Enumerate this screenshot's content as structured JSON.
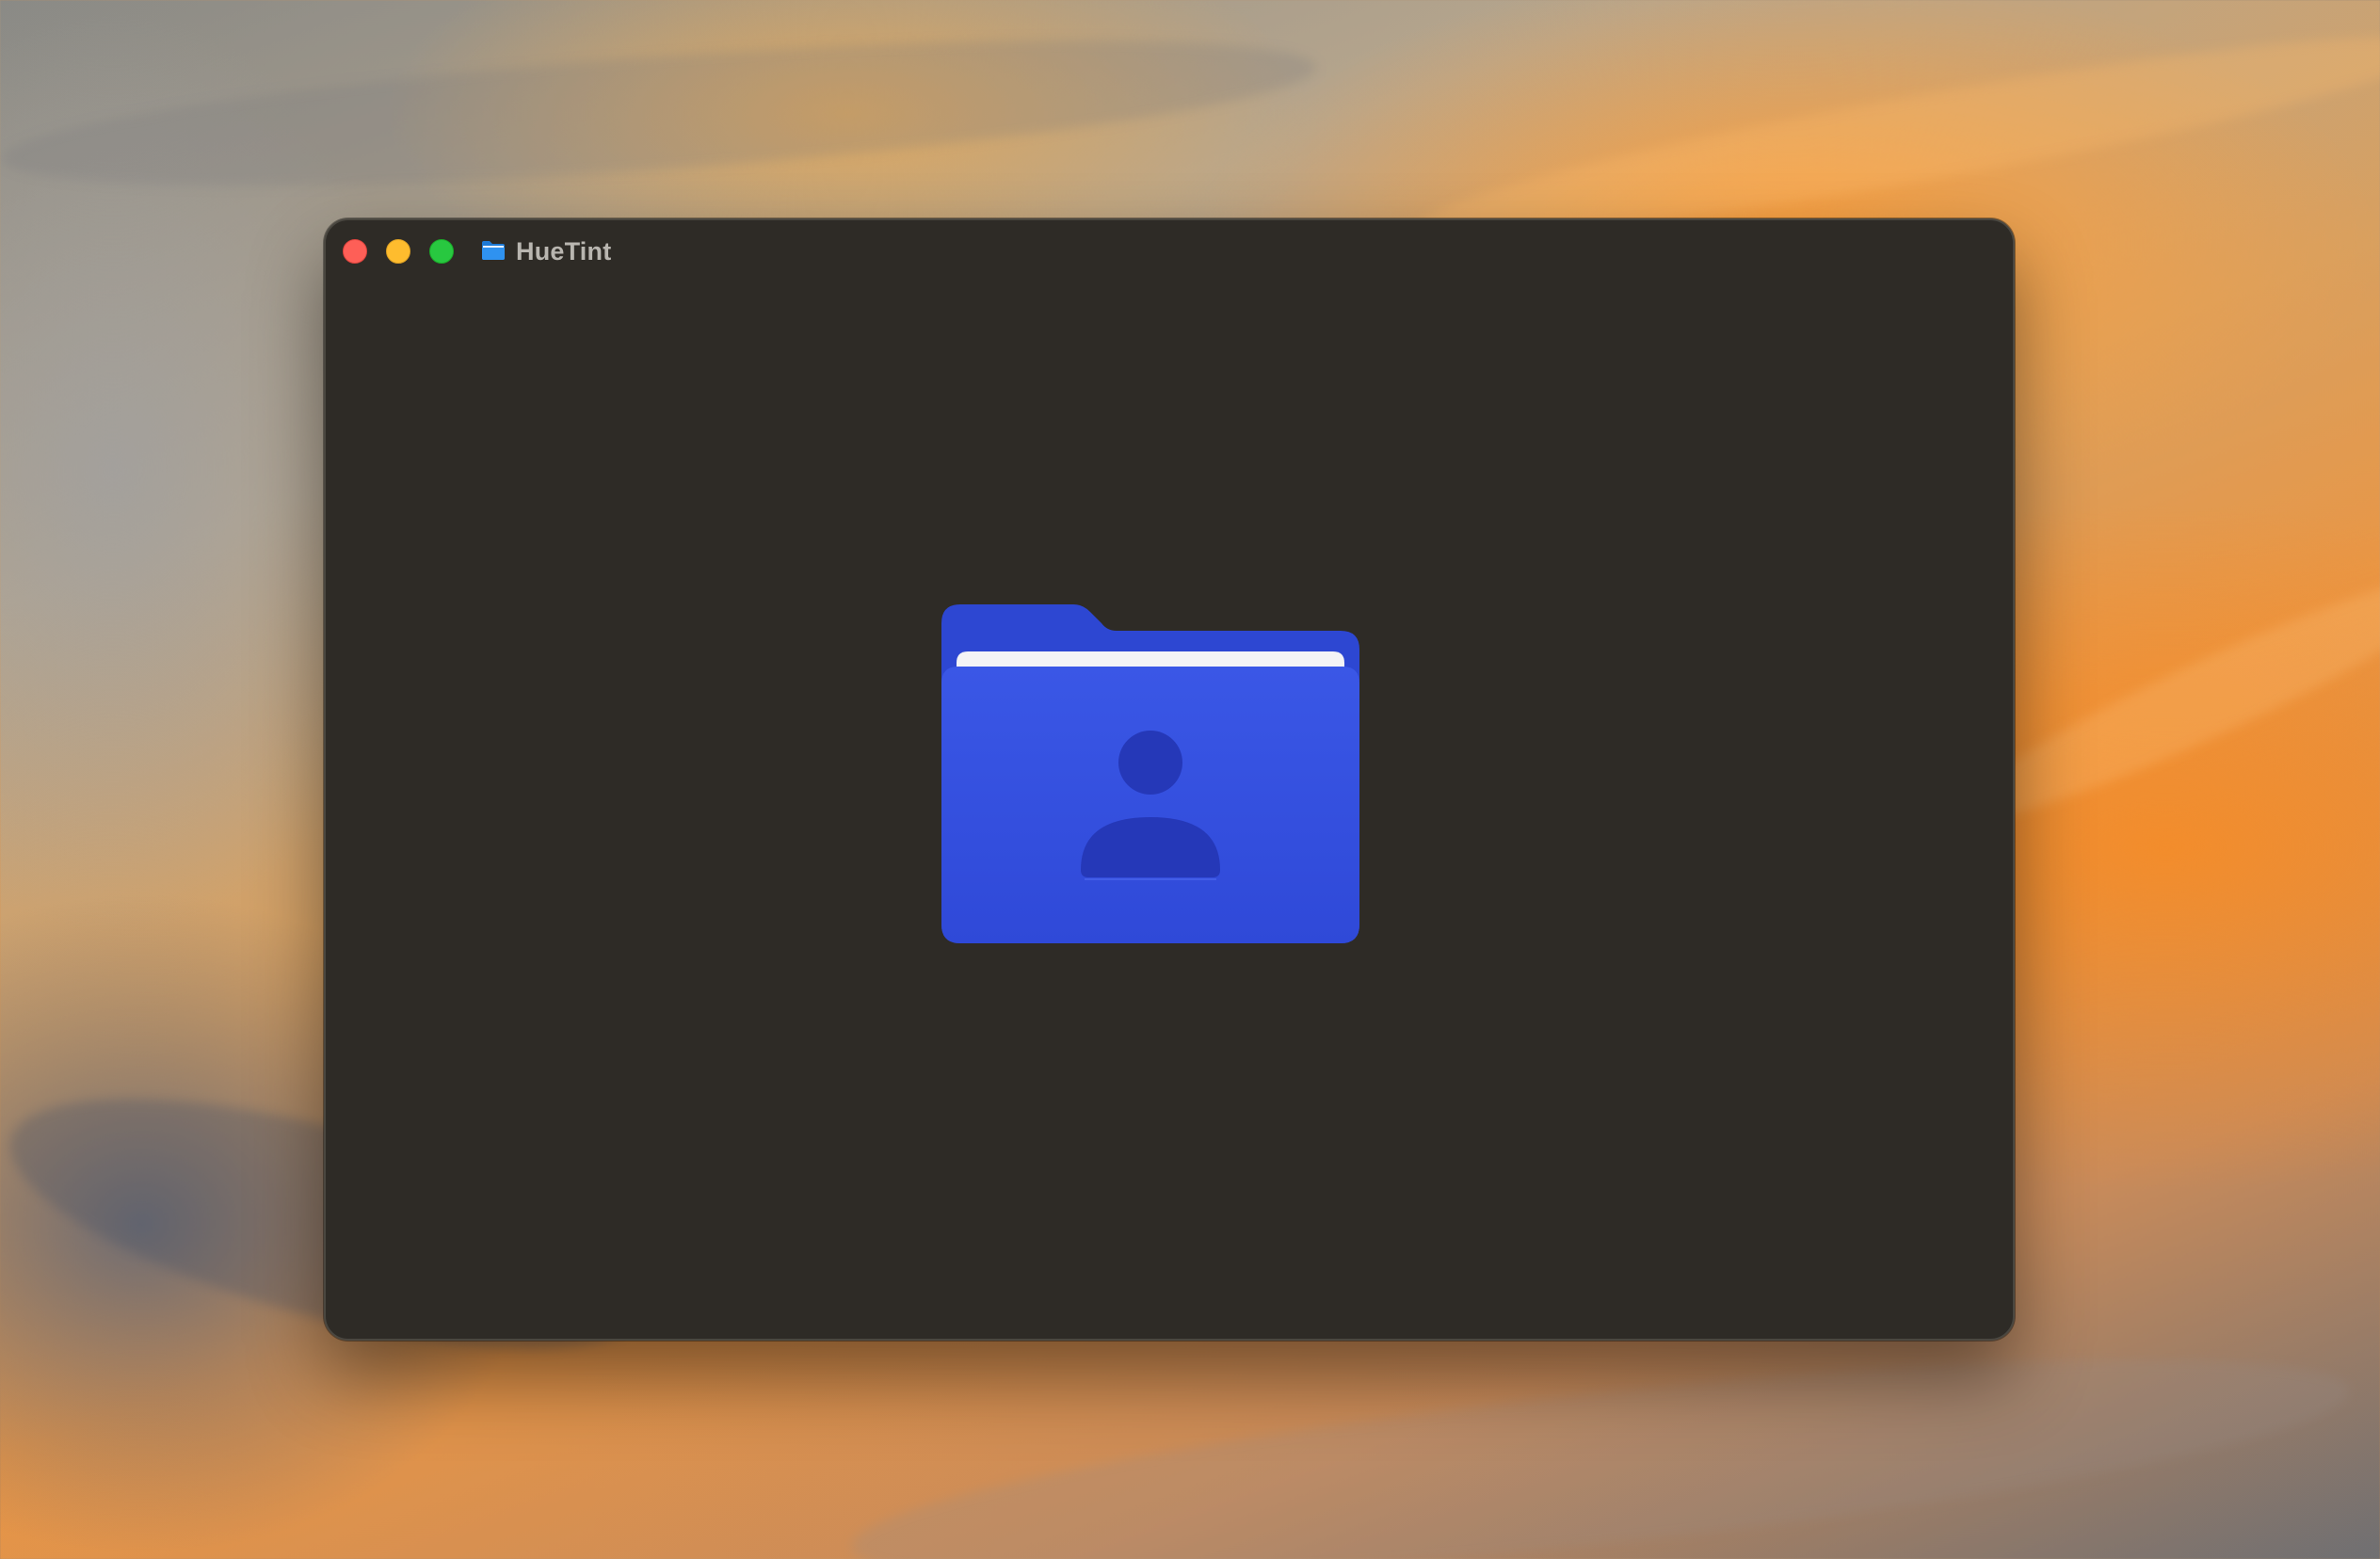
{
  "desktop": {
    "wallpaper_colors": [
      "#8a8a86",
      "#d8a060",
      "#e99645",
      "#6f6f72"
    ]
  },
  "window": {
    "title": "HueTint",
    "background": "#2e2b26",
    "title_icon": "folder-icon",
    "traffic_lights": {
      "close_color": "#fe5f57",
      "minimize_color": "#febc2e",
      "zoom_color": "#28c840"
    }
  },
  "content": {
    "icon": "user-folder-icon",
    "folder_color": "#3551e0"
  }
}
